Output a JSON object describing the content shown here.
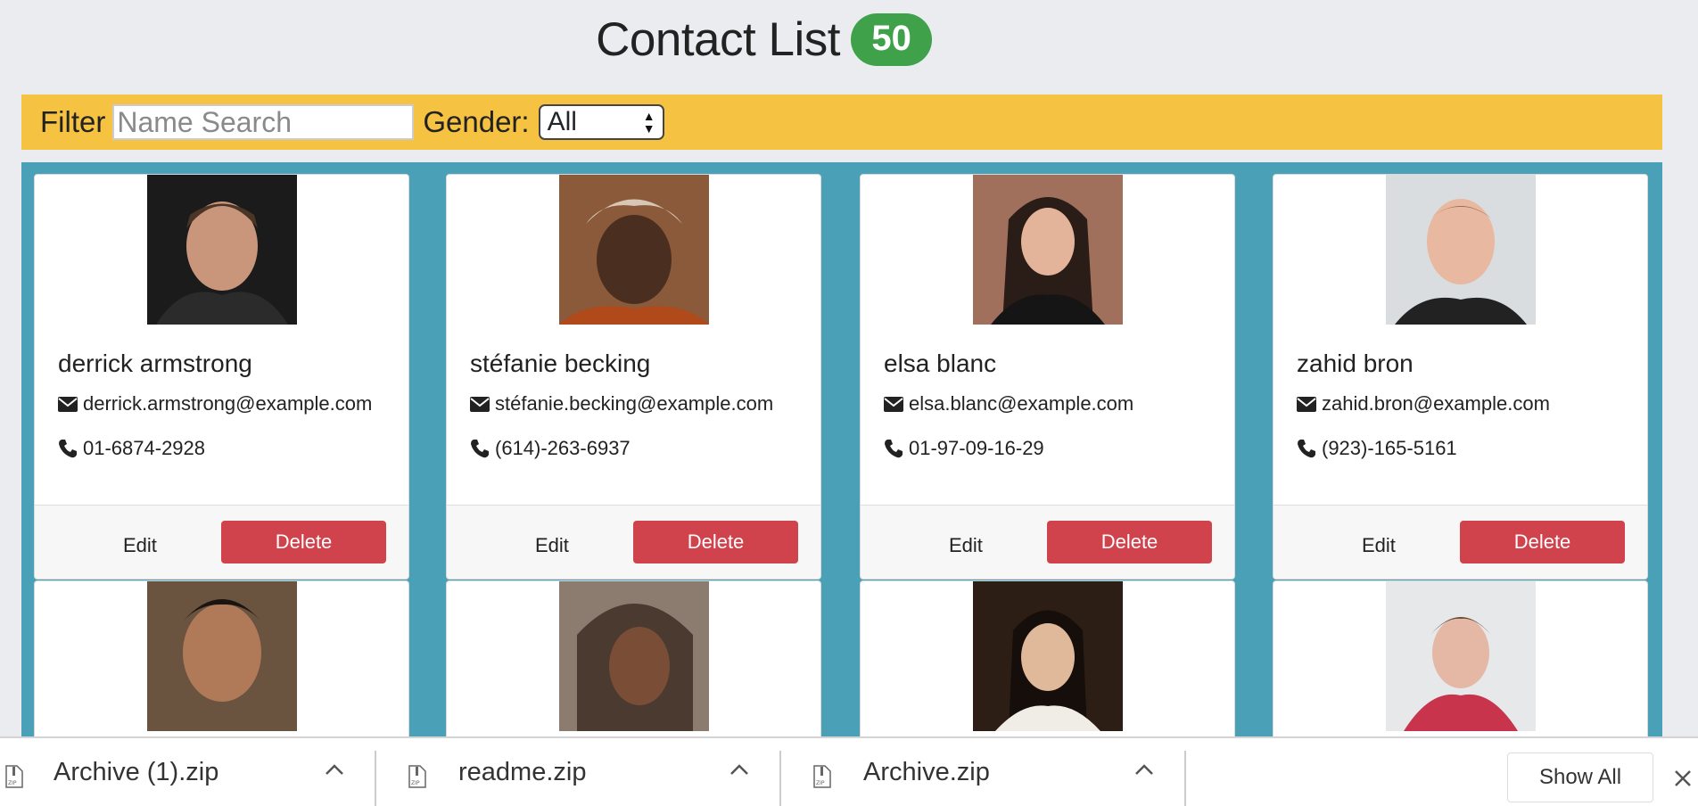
{
  "header": {
    "title": "Contact List",
    "count": "50"
  },
  "filter": {
    "label": "Filter",
    "placeholder": "Name Search",
    "gender_label": "Gender:",
    "gender_value": "All"
  },
  "contacts": [
    {
      "name": "derrick armstrong",
      "email": "derrick.armstrong@example.com",
      "phone": "01-6874-2928",
      "edit": "Edit",
      "delete": "Delete"
    },
    {
      "name": "stéfanie becking",
      "email": "stéfanie.becking@example.com",
      "phone": "(614)-263-6937",
      "edit": "Edit",
      "delete": "Delete"
    },
    {
      "name": "elsa blanc",
      "email": "elsa.blanc@example.com",
      "phone": "01-97-09-16-29",
      "edit": "Edit",
      "delete": "Delete"
    },
    {
      "name": "zahid bron",
      "email": "zahid.bron@example.com",
      "phone": "(923)-165-5161",
      "edit": "Edit",
      "delete": "Delete"
    }
  ],
  "downloads": {
    "items": [
      {
        "name": "Archive (1).zip"
      },
      {
        "name": "readme.zip"
      },
      {
        "name": "Archive.zip"
      }
    ],
    "show_all": "Show All"
  },
  "colors": {
    "accent_bar": "#f5c242",
    "grid_bg": "#4aa1b7",
    "delete": "#d0424c",
    "badge": "#3fa14a"
  }
}
